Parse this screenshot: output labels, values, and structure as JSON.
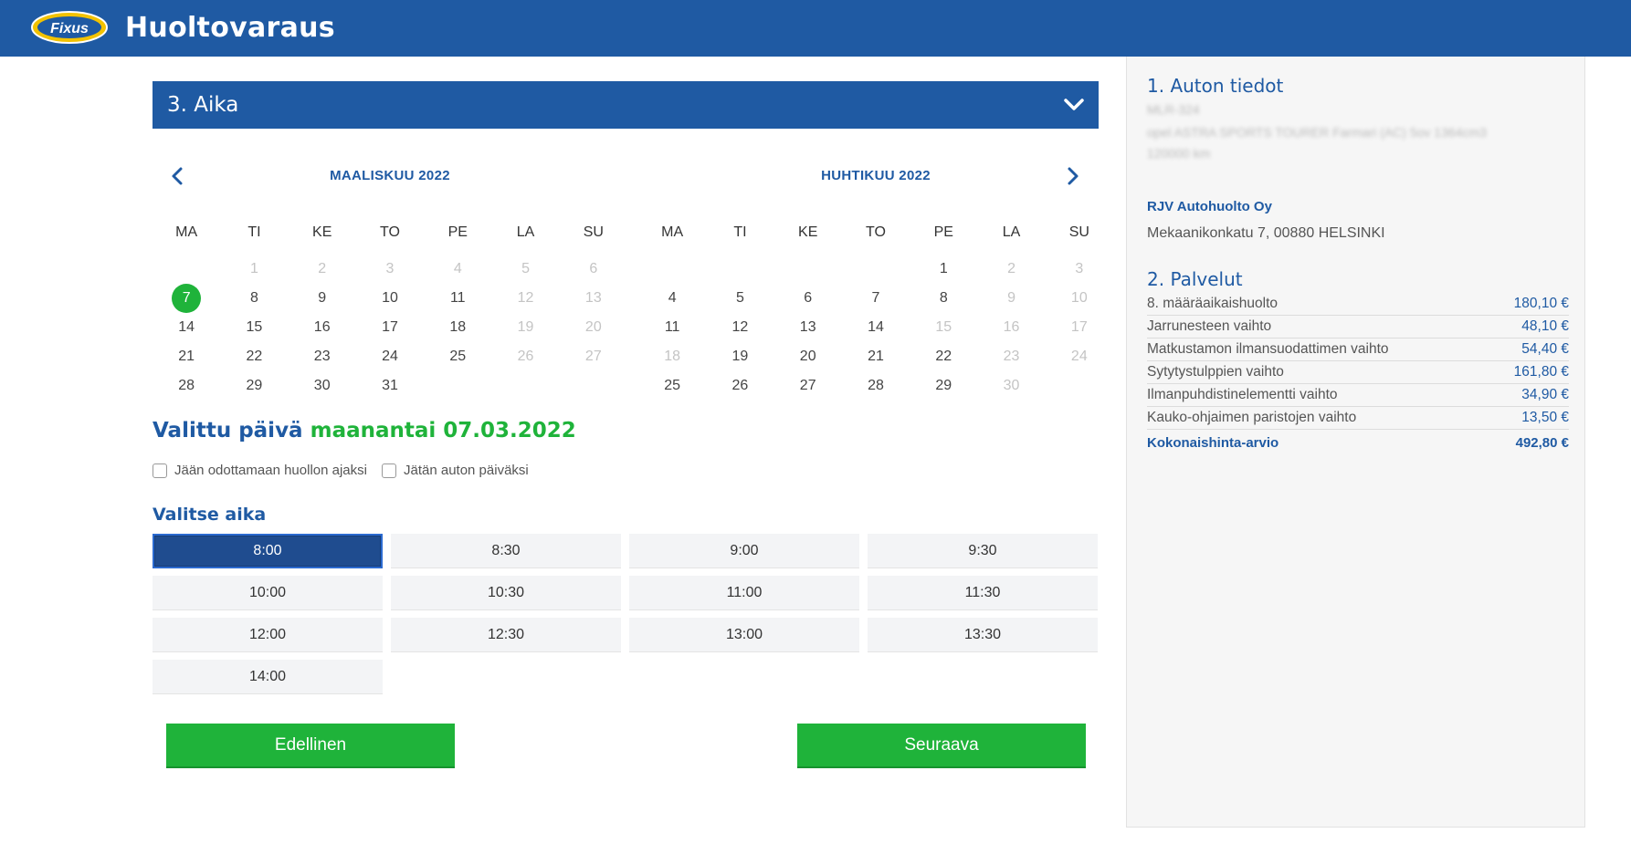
{
  "app": {
    "title": "Huoltovaraus",
    "logo_text": "Fixus",
    "brand_color": "#1f5aa3",
    "accent_color": "#1fb33a"
  },
  "section": {
    "title": "3. Aika",
    "toggle_icon": "chevron-down-icon"
  },
  "calendar": {
    "weekdays": [
      "MA",
      "TI",
      "KE",
      "TO",
      "PE",
      "LA",
      "SU"
    ],
    "months": [
      {
        "name": "MAALISKUU 2022",
        "weeks": [
          [
            {
              "d": "",
              "s": "empty"
            },
            {
              "d": "1",
              "s": "disabled"
            },
            {
              "d": "2",
              "s": "disabled"
            },
            {
              "d": "3",
              "s": "disabled"
            },
            {
              "d": "4",
              "s": "disabled"
            },
            {
              "d": "5",
              "s": "disabled"
            },
            {
              "d": "6",
              "s": "disabled"
            }
          ],
          [
            {
              "d": "7",
              "s": "selected"
            },
            {
              "d": "8",
              "s": "available"
            },
            {
              "d": "9",
              "s": "available"
            },
            {
              "d": "10",
              "s": "available"
            },
            {
              "d": "11",
              "s": "available"
            },
            {
              "d": "12",
              "s": "disabled"
            },
            {
              "d": "13",
              "s": "disabled"
            }
          ],
          [
            {
              "d": "14",
              "s": "available"
            },
            {
              "d": "15",
              "s": "available"
            },
            {
              "d": "16",
              "s": "available"
            },
            {
              "d": "17",
              "s": "available"
            },
            {
              "d": "18",
              "s": "available"
            },
            {
              "d": "19",
              "s": "disabled"
            },
            {
              "d": "20",
              "s": "disabled"
            }
          ],
          [
            {
              "d": "21",
              "s": "available"
            },
            {
              "d": "22",
              "s": "available"
            },
            {
              "d": "23",
              "s": "available"
            },
            {
              "d": "24",
              "s": "available"
            },
            {
              "d": "25",
              "s": "available"
            },
            {
              "d": "26",
              "s": "disabled"
            },
            {
              "d": "27",
              "s": "disabled"
            }
          ],
          [
            {
              "d": "28",
              "s": "available"
            },
            {
              "d": "29",
              "s": "available"
            },
            {
              "d": "30",
              "s": "available"
            },
            {
              "d": "31",
              "s": "available"
            },
            {
              "d": "",
              "s": "empty"
            },
            {
              "d": "",
              "s": "empty"
            },
            {
              "d": "",
              "s": "empty"
            }
          ]
        ]
      },
      {
        "name": "HUHTIKUU 2022",
        "weeks": [
          [
            {
              "d": "",
              "s": "empty"
            },
            {
              "d": "",
              "s": "empty"
            },
            {
              "d": "",
              "s": "empty"
            },
            {
              "d": "",
              "s": "empty"
            },
            {
              "d": "1",
              "s": "available"
            },
            {
              "d": "2",
              "s": "disabled"
            },
            {
              "d": "3",
              "s": "disabled"
            }
          ],
          [
            {
              "d": "4",
              "s": "available"
            },
            {
              "d": "5",
              "s": "available"
            },
            {
              "d": "6",
              "s": "available"
            },
            {
              "d": "7",
              "s": "available"
            },
            {
              "d": "8",
              "s": "available"
            },
            {
              "d": "9",
              "s": "disabled"
            },
            {
              "d": "10",
              "s": "disabled"
            }
          ],
          [
            {
              "d": "11",
              "s": "available"
            },
            {
              "d": "12",
              "s": "available"
            },
            {
              "d": "13",
              "s": "available"
            },
            {
              "d": "14",
              "s": "available"
            },
            {
              "d": "15",
              "s": "disabled"
            },
            {
              "d": "16",
              "s": "disabled"
            },
            {
              "d": "17",
              "s": "disabled"
            }
          ],
          [
            {
              "d": "18",
              "s": "disabled"
            },
            {
              "d": "19",
              "s": "available"
            },
            {
              "d": "20",
              "s": "available"
            },
            {
              "d": "21",
              "s": "available"
            },
            {
              "d": "22",
              "s": "available"
            },
            {
              "d": "23",
              "s": "disabled"
            },
            {
              "d": "24",
              "s": "disabled"
            }
          ],
          [
            {
              "d": "25",
              "s": "available"
            },
            {
              "d": "26",
              "s": "available"
            },
            {
              "d": "27",
              "s": "available"
            },
            {
              "d": "28",
              "s": "available"
            },
            {
              "d": "29",
              "s": "available"
            },
            {
              "d": "30",
              "s": "disabled"
            },
            {
              "d": "",
              "s": "empty"
            }
          ]
        ]
      }
    ]
  },
  "selected_date": {
    "label": "Valittu päivä",
    "value": "maanantai 07.03.2022"
  },
  "options": [
    {
      "label": "Jään odottamaan huollon ajaksi",
      "checked": false
    },
    {
      "label": "Jätän auton päiväksi",
      "checked": false
    }
  ],
  "time_selection": {
    "title": "Valitse aika",
    "slots": [
      "8:00",
      "8:30",
      "9:00",
      "9:30",
      "10:00",
      "10:30",
      "11:00",
      "11:30",
      "12:00",
      "12:30",
      "13:00",
      "13:30",
      "14:00"
    ],
    "selected": "8:00"
  },
  "buttons": {
    "previous": "Edellinen",
    "next": "Seuraava"
  },
  "sidebar": {
    "car_title": "1. Auton tiedot",
    "car_lines": [
      "MLR-324",
      "opel ASTRA SPORTS TOURER Farmari (AC) 5ov 1364cm3",
      "120000 km"
    ],
    "dealer": "RJV Autohuolto Oy",
    "address": "Mekaanikonkatu 7, 00880 HELSINKI",
    "services_title": "2. Palvelut",
    "services": [
      {
        "name": "8. määräaikaishuolto",
        "price": "180,10 €"
      },
      {
        "name": "Jarrunesteen vaihto",
        "price": "48,10 €"
      },
      {
        "name": "Matkustamon ilmansuodattimen vaihto",
        "price": "54,40 €"
      },
      {
        "name": "Sytytystulppien vaihto",
        "price": "161,80 €"
      },
      {
        "name": "Ilmanpuhdistinelementti vaihto",
        "price": "34,90 €"
      },
      {
        "name": "Kauko-ohjaimen paristojen vaihto",
        "price": "13,50 €"
      }
    ],
    "total_label": "Kokonaishinta-arvio",
    "total_value": "492,80 €"
  }
}
